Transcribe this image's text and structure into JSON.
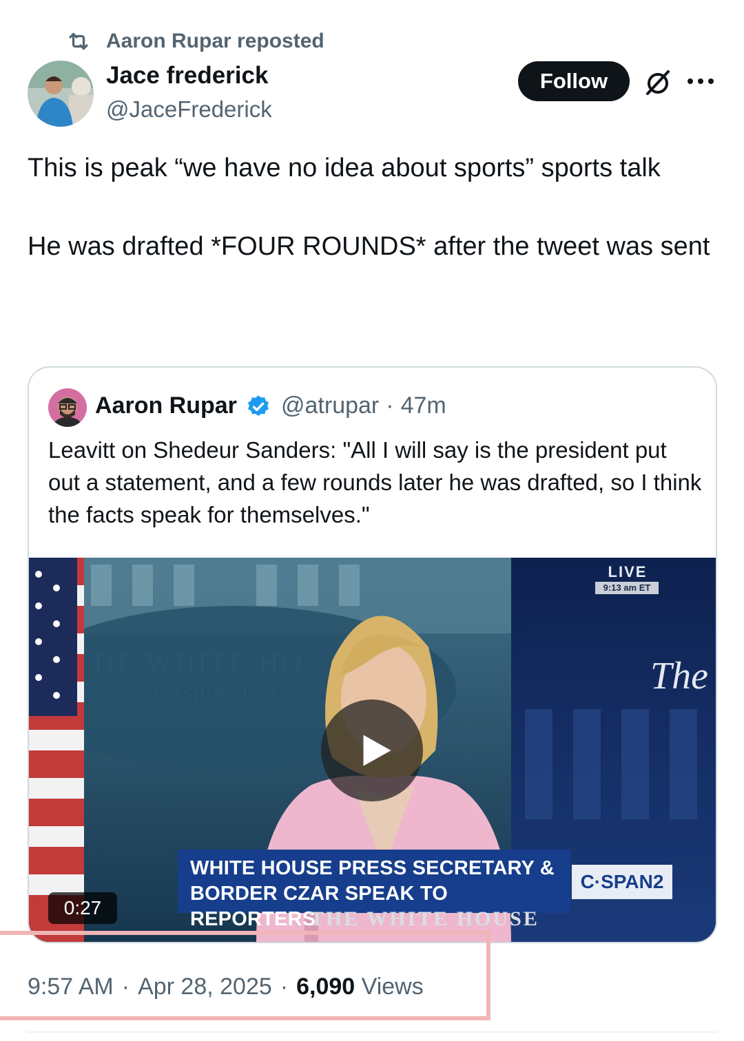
{
  "repost": {
    "label": "Aaron Rupar reposted",
    "icon": "repost-icon"
  },
  "author": {
    "name": "Jace frederick",
    "handle": "@JaceFrederick"
  },
  "actions": {
    "follow_label": "Follow",
    "grok_icon": "grok-icon",
    "more_icon": "more-icon"
  },
  "tweet": {
    "paragraphs": [
      "This is peak “we have no idea about sports” sports talk",
      "He was drafted *FOUR ROUNDS* after the tweet was sent"
    ]
  },
  "quote": {
    "name": "Aaron Rupar",
    "handle": "@atrupar",
    "separator": "·",
    "age": "47m",
    "text": "Leavitt on Shedeur Sanders: \"All I will say is the president put out a statement, and a few rounds later he was drafted, so I think the facts speak for themselves.\"",
    "verified_color": "#1d9bf0",
    "video": {
      "live_label": "LIVE",
      "live_time": "9:13 am ET",
      "backdrop_text": "HE WHITE HO",
      "backdrop_sub": "WASHINGTON",
      "side_text": "The",
      "lower_third": [
        "WHITE HOUSE PRESS SECRETARY &",
        "BORDER CZAR SPEAK TO REPORTERS"
      ],
      "network": "C·SPAN2",
      "podium_text": "THE WHITE HOUSE",
      "duration": "0:27"
    }
  },
  "meta": {
    "time": "9:57 AM",
    "date": "Apr 28, 2025",
    "sep": "·",
    "views_count": "6,090",
    "views_label": "Views"
  },
  "colors": {
    "text": "#0f1419",
    "secondary": "#536471",
    "border": "#cfd9de",
    "highlight": "#f0b5b5"
  }
}
